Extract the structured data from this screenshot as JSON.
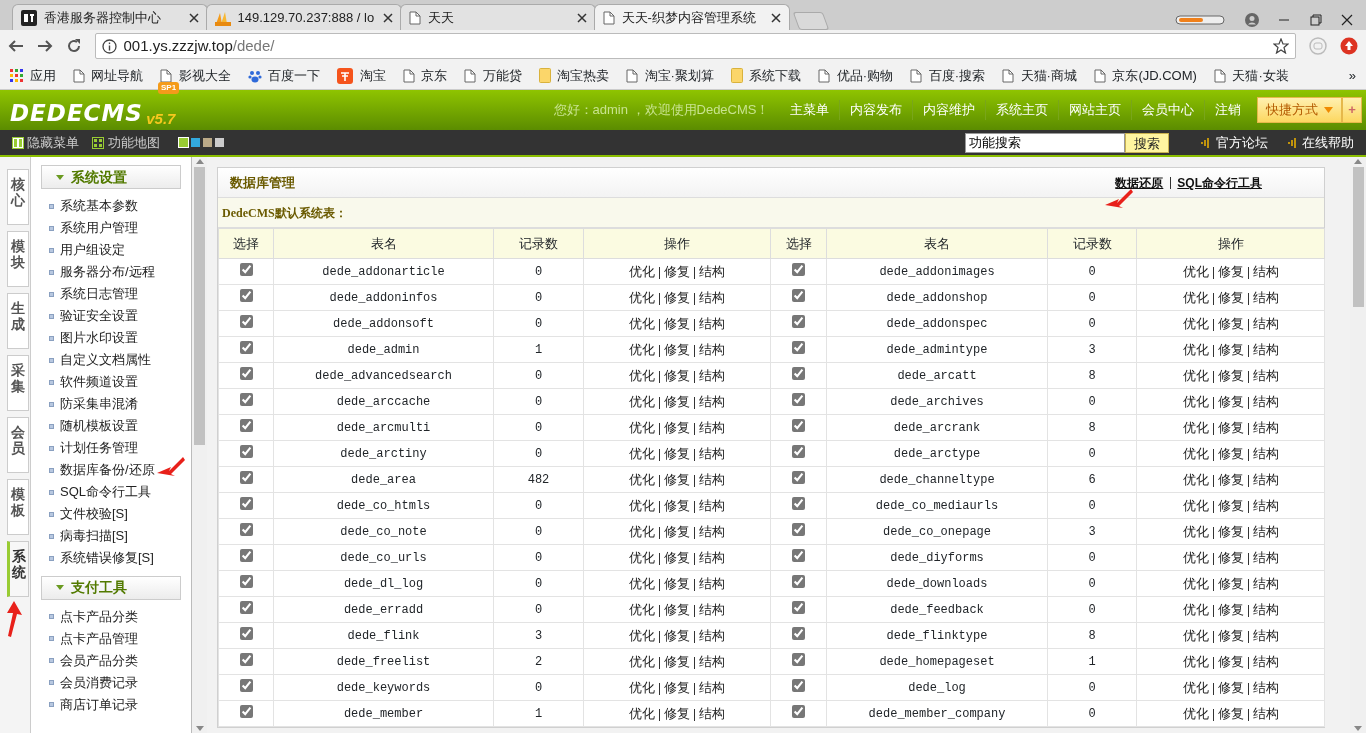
{
  "browser": {
    "tabs": [
      {
        "title": "香港服务器控制中心",
        "kind": "bt",
        "selected": false
      },
      {
        "title": "149.129.70.237:888 / lo",
        "kind": "pma",
        "selected": false
      },
      {
        "title": "天天",
        "kind": "page",
        "selected": false
      },
      {
        "title": "天天-织梦内容管理系统",
        "kind": "page",
        "selected": true
      }
    ],
    "address": {
      "host": "001.ys.zzzjw.top",
      "path": "/dede/"
    },
    "bookmarks": [
      {
        "label": "应用",
        "kind": "apps"
      },
      {
        "label": "网址导航",
        "kind": "page"
      },
      {
        "label": "影视大全",
        "kind": "page"
      },
      {
        "label": "百度一下",
        "kind": "paw"
      },
      {
        "label": "淘宝",
        "kind": "taobao"
      },
      {
        "label": "京东",
        "kind": "page"
      },
      {
        "label": "万能贷",
        "kind": "page"
      },
      {
        "label": "淘宝热卖",
        "kind": "folder"
      },
      {
        "label": "淘宝·聚划算",
        "kind": "page"
      },
      {
        "label": "系统下载",
        "kind": "folder"
      },
      {
        "label": "优品·购物",
        "kind": "page"
      },
      {
        "label": "百度·搜索",
        "kind": "page"
      },
      {
        "label": "天猫·商城",
        "kind": "page"
      },
      {
        "label": "京东(JD.COM)",
        "kind": "page"
      },
      {
        "label": "天猫·女装",
        "kind": "page"
      }
    ],
    "bookmarks_more": "»"
  },
  "header": {
    "logo": "DEDECMS",
    "version": "v5.7",
    "edition": "SP1",
    "greeting": "您好：admin ，欢迎使用DedeCMS！",
    "nav": [
      "主菜单",
      "内容发布",
      "内容维护",
      "系统主页",
      "网站主页",
      "会员中心",
      "注销"
    ],
    "shortcut": "快捷方式",
    "add": "+"
  },
  "toolbar": {
    "hide_menu": "隐藏菜单",
    "site_map": "功能地图",
    "themes": [
      {
        "color": "#99cc33",
        "selected": true
      },
      {
        "color": "#33aadd",
        "selected": false
      },
      {
        "color": "#bbaa88",
        "selected": false
      },
      {
        "color": "#cccccc",
        "selected": false
      }
    ],
    "search": {
      "value": "功能搜索",
      "button": "搜索"
    },
    "links": [
      "官方论坛",
      "在线帮助"
    ]
  },
  "side_tabs": [
    {
      "label": "核心",
      "selected": false,
      "annotated": false
    },
    {
      "label": "模块",
      "selected": false,
      "annotated": false
    },
    {
      "label": "生成",
      "selected": false,
      "annotated": false
    },
    {
      "label": "采集",
      "selected": false,
      "annotated": false
    },
    {
      "label": "会员",
      "selected": false,
      "annotated": false
    },
    {
      "label": "模板",
      "selected": false,
      "annotated": false
    },
    {
      "label": "系统",
      "selected": true,
      "annotated": true
    }
  ],
  "menu": [
    {
      "title": "系统设置",
      "expanded": true,
      "items": [
        {
          "label": "系统基本参数",
          "annotated": false
        },
        {
          "label": "系统用户管理",
          "annotated": false
        },
        {
          "label": "用户组设定",
          "annotated": false
        },
        {
          "label": "服务器分布/远程",
          "annotated": false
        },
        {
          "label": "系统日志管理",
          "annotated": false
        },
        {
          "label": "验证安全设置",
          "annotated": false
        },
        {
          "label": "图片水印设置",
          "annotated": false
        },
        {
          "label": "自定义文档属性",
          "annotated": false
        },
        {
          "label": "软件频道设置",
          "annotated": false
        },
        {
          "label": "防采集串混淆",
          "annotated": false
        },
        {
          "label": "随机模板设置",
          "annotated": false
        },
        {
          "label": "计划任务管理",
          "annotated": false
        },
        {
          "label": "数据库备份/还原",
          "annotated": true
        },
        {
          "label": "SQL命令行工具",
          "annotated": false
        },
        {
          "label": "文件校验[S]",
          "annotated": false
        },
        {
          "label": "病毒扫描[S]",
          "annotated": false
        },
        {
          "label": "系统错误修复[S]",
          "annotated": false
        }
      ]
    },
    {
      "title": "支付工具",
      "expanded": true,
      "items": [
        {
          "label": "点卡产品分类",
          "annotated": false
        },
        {
          "label": "点卡产品管理",
          "annotated": false
        },
        {
          "label": "会员产品分类",
          "annotated": false
        },
        {
          "label": "会员消费记录",
          "annotated": false
        },
        {
          "label": "商店订单记录",
          "annotated": false
        }
      ]
    }
  ],
  "content": {
    "title": "数据库管理",
    "links": [
      {
        "label": "数据还原",
        "annotated": true
      },
      {
        "label": "SQL命令行工具",
        "annotated": false
      }
    ],
    "section": "DedeCMS默认系统表：",
    "columns": [
      "选择",
      "表名",
      "记录数",
      "操作",
      "选择",
      "表名",
      "记录数",
      "操作"
    ],
    "rows": [
      [
        {
          "checked": true
        },
        "dede_addonarticle",
        "0",
        [
          "优化",
          "修复",
          "结构"
        ],
        {
          "checked": true
        },
        "dede_addonimages",
        "0",
        [
          "优化",
          "修复",
          "结构"
        ]
      ],
      [
        {
          "checked": true
        },
        "dede_addoninfos",
        "0",
        [
          "优化",
          "修复",
          "结构"
        ],
        {
          "checked": true
        },
        "dede_addonshop",
        "0",
        [
          "优化",
          "修复",
          "结构"
        ]
      ],
      [
        {
          "checked": true
        },
        "dede_addonsoft",
        "0",
        [
          "优化",
          "修复",
          "结构"
        ],
        {
          "checked": true
        },
        "dede_addonspec",
        "0",
        [
          "优化",
          "修复",
          "结构"
        ]
      ],
      [
        {
          "checked": true
        },
        "dede_admin",
        "1",
        [
          "优化",
          "修复",
          "结构"
        ],
        {
          "checked": true
        },
        "dede_admintype",
        "3",
        [
          "优化",
          "修复",
          "结构"
        ]
      ],
      [
        {
          "checked": true
        },
        "dede_advancedsearch",
        "0",
        [
          "优化",
          "修复",
          "结构"
        ],
        {
          "checked": true
        },
        "dede_arcatt",
        "8",
        [
          "优化",
          "修复",
          "结构"
        ]
      ],
      [
        {
          "checked": true
        },
        "dede_arccache",
        "0",
        [
          "优化",
          "修复",
          "结构"
        ],
        {
          "checked": true
        },
        "dede_archives",
        "0",
        [
          "优化",
          "修复",
          "结构"
        ]
      ],
      [
        {
          "checked": true
        },
        "dede_arcmulti",
        "0",
        [
          "优化",
          "修复",
          "结构"
        ],
        {
          "checked": true
        },
        "dede_arcrank",
        "8",
        [
          "优化",
          "修复",
          "结构"
        ]
      ],
      [
        {
          "checked": true
        },
        "dede_arctiny",
        "0",
        [
          "优化",
          "修复",
          "结构"
        ],
        {
          "checked": true
        },
        "dede_arctype",
        "0",
        [
          "优化",
          "修复",
          "结构"
        ]
      ],
      [
        {
          "checked": true
        },
        "dede_area",
        "482",
        [
          "优化",
          "修复",
          "结构"
        ],
        {
          "checked": true
        },
        "dede_channeltype",
        "6",
        [
          "优化",
          "修复",
          "结构"
        ]
      ],
      [
        {
          "checked": true
        },
        "dede_co_htmls",
        "0",
        [
          "优化",
          "修复",
          "结构"
        ],
        {
          "checked": true
        },
        "dede_co_mediaurls",
        "0",
        [
          "优化",
          "修复",
          "结构"
        ]
      ],
      [
        {
          "checked": true
        },
        "dede_co_note",
        "0",
        [
          "优化",
          "修复",
          "结构"
        ],
        {
          "checked": true
        },
        "dede_co_onepage",
        "3",
        [
          "优化",
          "修复",
          "结构"
        ]
      ],
      [
        {
          "checked": true
        },
        "dede_co_urls",
        "0",
        [
          "优化",
          "修复",
          "结构"
        ],
        {
          "checked": true
        },
        "dede_diyforms",
        "0",
        [
          "优化",
          "修复",
          "结构"
        ]
      ],
      [
        {
          "checked": true
        },
        "dede_dl_log",
        "0",
        [
          "优化",
          "修复",
          "结构"
        ],
        {
          "checked": true
        },
        "dede_downloads",
        "0",
        [
          "优化",
          "修复",
          "结构"
        ]
      ],
      [
        {
          "checked": true
        },
        "dede_erradd",
        "0",
        [
          "优化",
          "修复",
          "结构"
        ],
        {
          "checked": true
        },
        "dede_feedback",
        "0",
        [
          "优化",
          "修复",
          "结构"
        ]
      ],
      [
        {
          "checked": true
        },
        "dede_flink",
        "3",
        [
          "优化",
          "修复",
          "结构"
        ],
        {
          "checked": true
        },
        "dede_flinktype",
        "8",
        [
          "优化",
          "修复",
          "结构"
        ]
      ],
      [
        {
          "checked": true
        },
        "dede_freelist",
        "2",
        [
          "优化",
          "修复",
          "结构"
        ],
        {
          "checked": true
        },
        "dede_homepageset",
        "1",
        [
          "优化",
          "修复",
          "结构"
        ]
      ],
      [
        {
          "checked": true
        },
        "dede_keywords",
        "0",
        [
          "优化",
          "修复",
          "结构"
        ],
        {
          "checked": true
        },
        "dede_log",
        "0",
        [
          "优化",
          "修复",
          "结构"
        ]
      ],
      [
        {
          "checked": true
        },
        "dede_member",
        "1",
        [
          "优化",
          "修复",
          "结构"
        ],
        {
          "checked": true
        },
        "dede_member_company",
        "0",
        [
          "优化",
          "修复",
          "结构"
        ]
      ]
    ]
  }
}
